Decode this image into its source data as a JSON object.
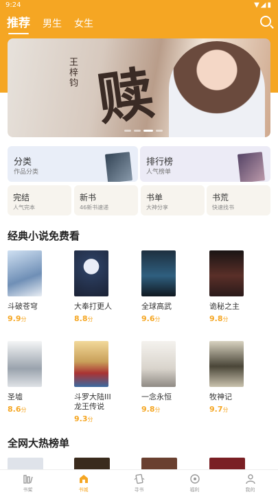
{
  "status": {
    "time": "9:24",
    "icons": "▼◢▮"
  },
  "tabs": [
    {
      "label": "推荐",
      "active": true
    },
    {
      "label": "男生",
      "active": false
    },
    {
      "label": "女生",
      "active": false
    }
  ],
  "banner": {
    "calligraphy": "赎",
    "author": "王梓钧"
  },
  "categories": [
    {
      "title": "分类",
      "subtitle": "作品分类"
    },
    {
      "title": "排行榜",
      "subtitle": "人气榜单"
    }
  ],
  "shortcuts": [
    {
      "title": "完结",
      "subtitle": "人气完本"
    },
    {
      "title": "新书",
      "subtitle": "46新书速递"
    },
    {
      "title": "书单",
      "subtitle": "大神分享"
    },
    {
      "title": "书荒",
      "subtitle": "快速找书"
    }
  ],
  "free_section": {
    "title": "经典小说免费看",
    "score_unit": "分",
    "books": [
      {
        "name": "斗破苍穹",
        "score": "9.9",
        "color": "#6f8fb6"
      },
      {
        "name": "大奉打更人",
        "score": "8.8",
        "color": "#2b3d5e"
      },
      {
        "name": "全球高武",
        "score": "9.6",
        "color": "#2f5f7f"
      },
      {
        "name": "诡秘之主",
        "score": "9.8",
        "color": "#3a2a2a"
      },
      {
        "name": "圣墟",
        "score": "8.6",
        "color": "#9aa3ad"
      },
      {
        "name": "斗罗大陆III龙王传说",
        "score": "9.3",
        "color": "#c9a05a"
      },
      {
        "name": "一念永恒",
        "score": "9.8",
        "color": "#d9d4cc"
      },
      {
        "name": "牧神记",
        "score": "9.7",
        "color": "#4a4638"
      }
    ]
  },
  "hot_section": {
    "title": "全网大热榜单"
  },
  "nav": [
    {
      "label": "书架",
      "icon": "bookshelf-icon",
      "active": false
    },
    {
      "label": "书城",
      "icon": "store-icon",
      "active": true
    },
    {
      "label": "寻书",
      "icon": "find-book-icon",
      "active": false
    },
    {
      "label": "福利",
      "icon": "welfare-icon",
      "active": false
    },
    {
      "label": "我的",
      "icon": "profile-icon",
      "active": false
    }
  ],
  "colors": {
    "accent": "#f5a623"
  }
}
